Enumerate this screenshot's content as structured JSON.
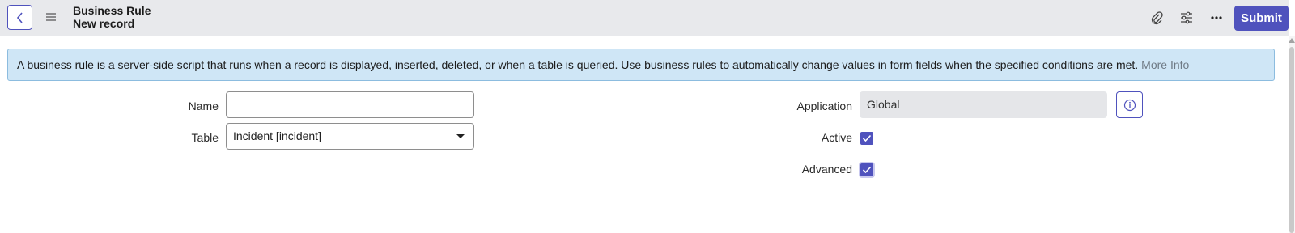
{
  "header": {
    "title": "Business Rule",
    "subtitle": "New record",
    "submit_label": "Submit",
    "icons": [
      "back-icon",
      "menu-icon",
      "paperclip-icon",
      "sliders-icon",
      "more-icon"
    ],
    "accent_color": "#4f52bd"
  },
  "banner": {
    "text": "A business rule is a server-side script that runs when a record is displayed, inserted, deleted, or when a table is queried. Use business rules to automatically change values in form fields when the specified conditions are met.",
    "link_text": "More Info"
  },
  "form": {
    "name_label": "Name",
    "name_value": "",
    "table_label": "Table",
    "table_value": "Incident [incident]",
    "application_label": "Application",
    "application_value": "Global",
    "active_label": "Active",
    "active_checked": true,
    "advanced_label": "Advanced",
    "advanced_checked": true
  }
}
